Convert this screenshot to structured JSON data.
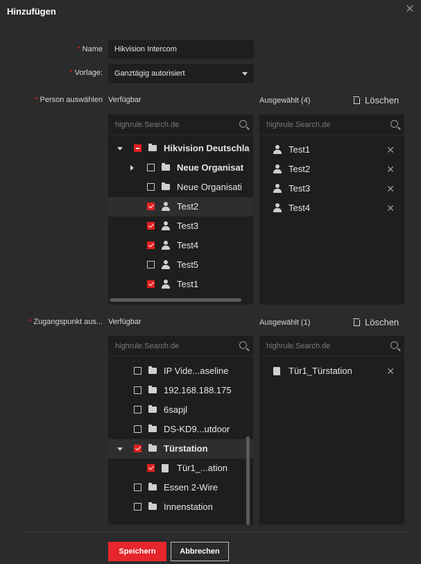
{
  "dialog": {
    "title": "Hinzufügen",
    "close_icon": "close-icon"
  },
  "form": {
    "name_label": "Name",
    "name_value": "Hikvision Intercom",
    "template_label": "Vorlage:",
    "template_value": "Ganztägig autorisiert",
    "person_label": "Person auswählen",
    "access_label": "Zugangspunkt aus..."
  },
  "persons": {
    "available_label": "Verfügbar",
    "selected_label": "Ausgewählt (4)",
    "clear_label": "Löschen",
    "search_placeholder": "highrule.Search.de",
    "tree": [
      {
        "label": "Hikvision Deutschla",
        "state": "partial",
        "type": "folder",
        "bold": true,
        "expander": "down"
      },
      {
        "label": "Neue Organisat",
        "state": "unchecked",
        "type": "folder",
        "bold": true,
        "expander": "right"
      },
      {
        "label": "Neue Organisati",
        "state": "unchecked",
        "type": "folder",
        "bold": false
      },
      {
        "label": "Test2",
        "state": "checked",
        "type": "person",
        "selected": true
      },
      {
        "label": "Test3",
        "state": "checked",
        "type": "person"
      },
      {
        "label": "Test4",
        "state": "checked",
        "type": "person"
      },
      {
        "label": "Test5",
        "state": "unchecked",
        "type": "person"
      },
      {
        "label": "Test1",
        "state": "checked",
        "type": "person"
      }
    ],
    "selected": [
      "Test1",
      "Test2",
      "Test3",
      "Test4"
    ]
  },
  "access_points": {
    "available_label": "Verfügbar",
    "selected_label": "Ausgewählt (1)",
    "clear_label": "Löschen",
    "search_placeholder": "highrule.Search.de",
    "tree": [
      {
        "label": "IP Vide...aseline",
        "state": "unchecked",
        "type": "folder"
      },
      {
        "label": "192.168.188.175",
        "state": "unchecked",
        "type": "folder"
      },
      {
        "label": "6sapjl",
        "state": "unchecked",
        "type": "folder"
      },
      {
        "label": "DS-KD9...utdoor",
        "state": "unchecked",
        "type": "folder"
      },
      {
        "label": "Türstation",
        "state": "checked",
        "type": "folder",
        "bold": true,
        "expander": "down",
        "selected": true
      },
      {
        "label": "Tür1_...ation",
        "state": "checked",
        "type": "device"
      },
      {
        "label": "Essen 2-Wire",
        "state": "unchecked",
        "type": "folder"
      },
      {
        "label": "Innenstation",
        "state": "unchecked",
        "type": "folder"
      }
    ],
    "selected": [
      "Tür1_Türstation"
    ]
  },
  "footer": {
    "save_label": "Speichern",
    "cancel_label": "Abbrechen"
  },
  "colors": {
    "accent": "#e5262b",
    "background": "#2b2b2b",
    "panel": "#1e1e1e"
  }
}
